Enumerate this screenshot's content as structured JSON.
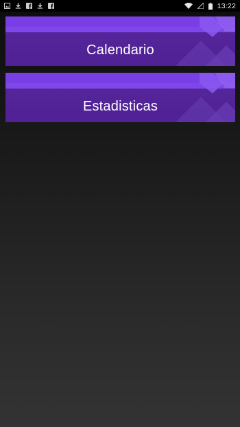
{
  "status_bar": {
    "time": "13:22",
    "left_icons": [
      "image-icon",
      "download-icon",
      "facebook-icon",
      "download-icon",
      "facebook-icon"
    ],
    "right_icons": [
      "wifi-icon",
      "signal-icon",
      "battery-icon"
    ]
  },
  "menu": {
    "items": [
      {
        "label": "Calendario"
      },
      {
        "label": "Estadisticas"
      }
    ]
  },
  "colors": {
    "card_top": "#7a3fe4",
    "card_body": "#55259a",
    "label": "#ffffff"
  }
}
